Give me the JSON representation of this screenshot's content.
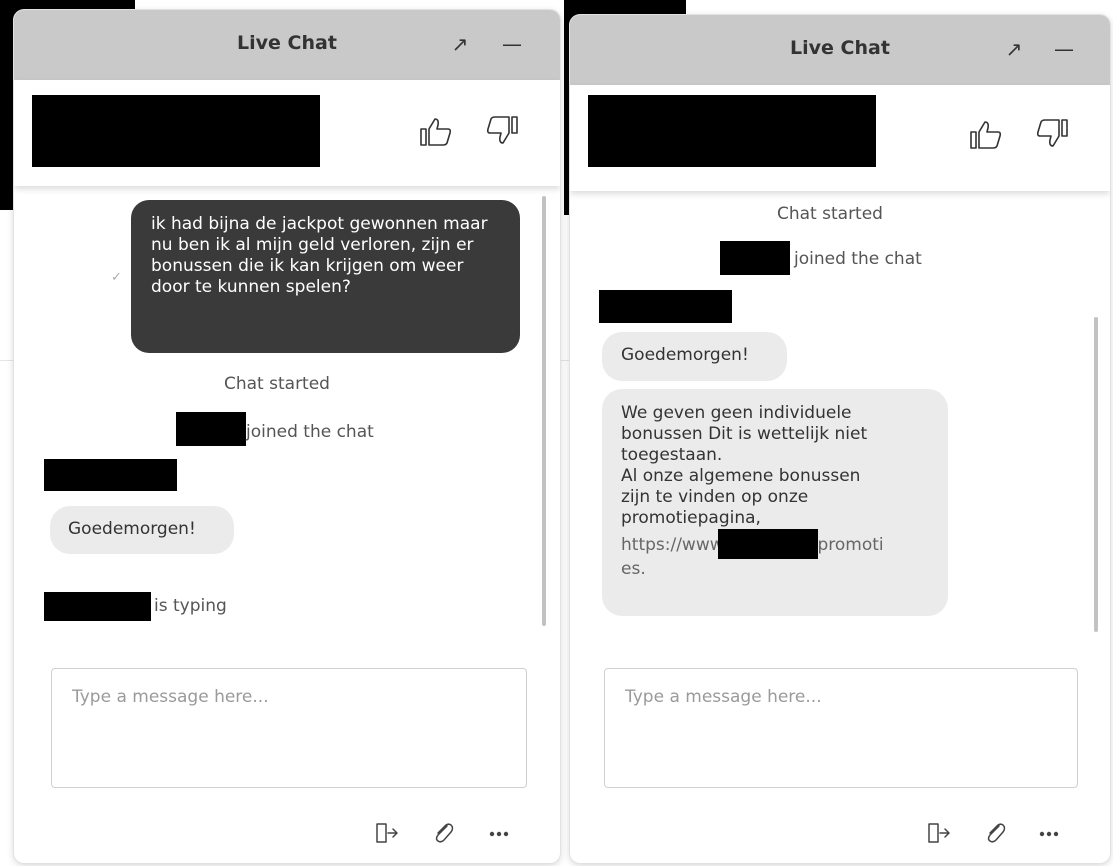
{
  "windows": [
    {
      "title": "Live Chat",
      "popout_icon": "↗",
      "minimize_icon": "—",
      "messages": {
        "visitor_message": "ik had bijna de jackpot gewonnen maar nu ben ik al mijn geld verloren, zijn er bonussen die ik kan krijgen om weer door te kunnen spelen?",
        "chat_started": "Chat started",
        "joined_text": "joined the chat",
        "agent_greeting": "Goedemorgen!",
        "typing_text": "is typing"
      },
      "input_placeholder": "Type a message here..."
    },
    {
      "title": "Live Chat",
      "popout_icon": "↗",
      "minimize_icon": "—",
      "messages": {
        "chat_started": "Chat started",
        "joined_text": "joined the chat",
        "agent_greeting": "Goedemorgen!",
        "agent_reply": {
          "line1": "We geven geen individuele",
          "line2": "bonussen Dit is wettelijk niet",
          "line3": "toegestaan.",
          "line4": "Al onze algemene bonussen",
          "line5": "zijn te vinden op onze",
          "line6": "promotiepagina,",
          "link_prefix": "https://www.",
          "link_suffix": "promoti",
          "link_end": "es."
        }
      },
      "input_placeholder": "Type a message here..."
    }
  ],
  "icons": {
    "thumbs_up": "thumbs-up-icon",
    "thumbs_down": "thumbs-down-icon",
    "exit": "exit-icon",
    "attach": "paperclip-icon",
    "more": "more-icon"
  },
  "colors": {
    "header_bg": "#c9c9c9",
    "visitor_bubble": "#3a3a3a",
    "agent_bubble": "#ebebeb",
    "link": "#666666"
  }
}
